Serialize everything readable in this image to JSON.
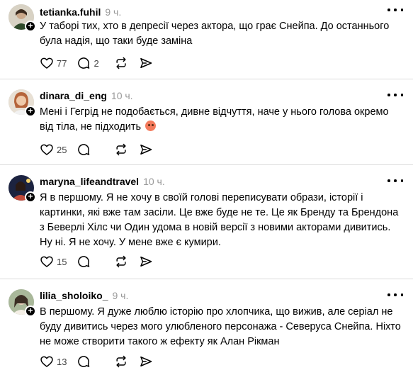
{
  "posts": [
    {
      "username": "tetianka.fuhil",
      "time": "9 ч.",
      "text": "У таборі тих, хто в депресії через актора, що грає Снейпа. До останнього була надія, що таки буде заміна",
      "likes": "77",
      "replies": "2",
      "avatar_colors": [
        "#2f4a2a",
        "#c9b79a"
      ]
    },
    {
      "username": "dinara_di_eng",
      "time": "10 ч.",
      "text": "Мені і Гегрід не подобається, дивне відчуття, наче у нього голова окремо від тіла, не підходить",
      "emoji": "face-with-steam-emoji",
      "likes": "25",
      "replies": "",
      "avatar_colors": [
        "#b5643a",
        "#e8d7c4"
      ]
    },
    {
      "username": "maryna_lifeandtravel",
      "time": "10 ч.",
      "text": "Я в першому. Я не хочу в своїй голові переписувати образи, історії і картинки, які вже там засіли. Це вже буде не те. Це як Бренду та Брендона з Беверлі Хілс чи Один удома в новій версії з новими акторами дивитись. Ну ні. Я не хочу. У мене вже є кумири.",
      "likes": "15",
      "replies": "",
      "avatar_colors": [
        "#1c2340",
        "#c24a3a"
      ]
    },
    {
      "username": "lilia_sholoiko_",
      "time": "9 ч.",
      "text": "В першому. Я дуже люблю історію про хлопчика, що вижив, але серіал не буду дивитись через мого улюбленого персонажа - Северуса Снейпа. Ніхто не може створити такого ж ефекту як Алан Рікман",
      "likes": "13",
      "replies": "",
      "avatar_colors": [
        "#7a8e6a",
        "#e9ddcc"
      ]
    }
  ],
  "icons": {
    "like": "heart-icon",
    "reply": "comment-icon",
    "repost": "repost-icon",
    "share": "send-icon",
    "more": "more-dots-icon",
    "follow": "plus-icon"
  }
}
